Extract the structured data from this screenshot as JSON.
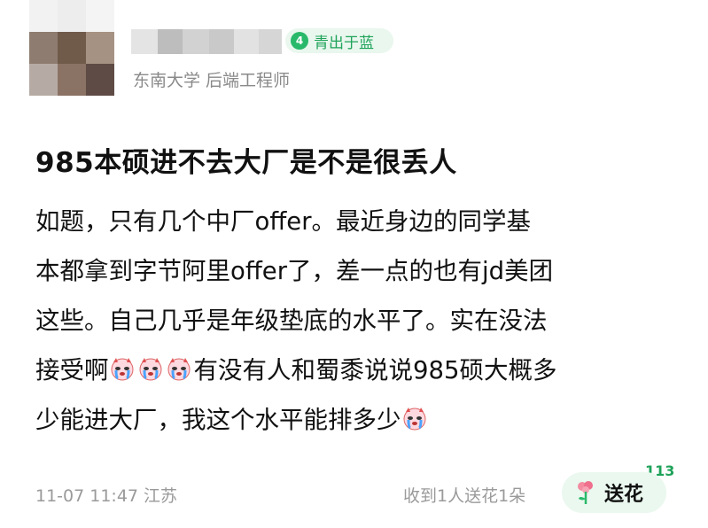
{
  "author": {
    "level_badge": {
      "level": "4",
      "label": "青出于蓝",
      "color": "#29b96a"
    },
    "subtitle": "东南大学 后端工程师"
  },
  "post": {
    "title": "985本硕进不去大厂是不是很丢人",
    "lines": [
      "如题，只有几个中厂offer。最近身边的同学基",
      "本都拿到字节阿里offer了，差一点的也有jd美团",
      "这些。自己几乎是年级垫底的水平了。实在没法",
      "接受啊",
      "有没有人和蜀黍说说985硕大概多",
      "少能进大厂，我这个水平能排多少"
    ],
    "emoji_icon": "crying-devil-emoji"
  },
  "footer": {
    "timestamp": "11-07 11:47 江苏",
    "flowers_received": "收到1人送花1朵",
    "flower_count": "113",
    "send_flower_label": "送花",
    "accent": "#1fa35a"
  }
}
